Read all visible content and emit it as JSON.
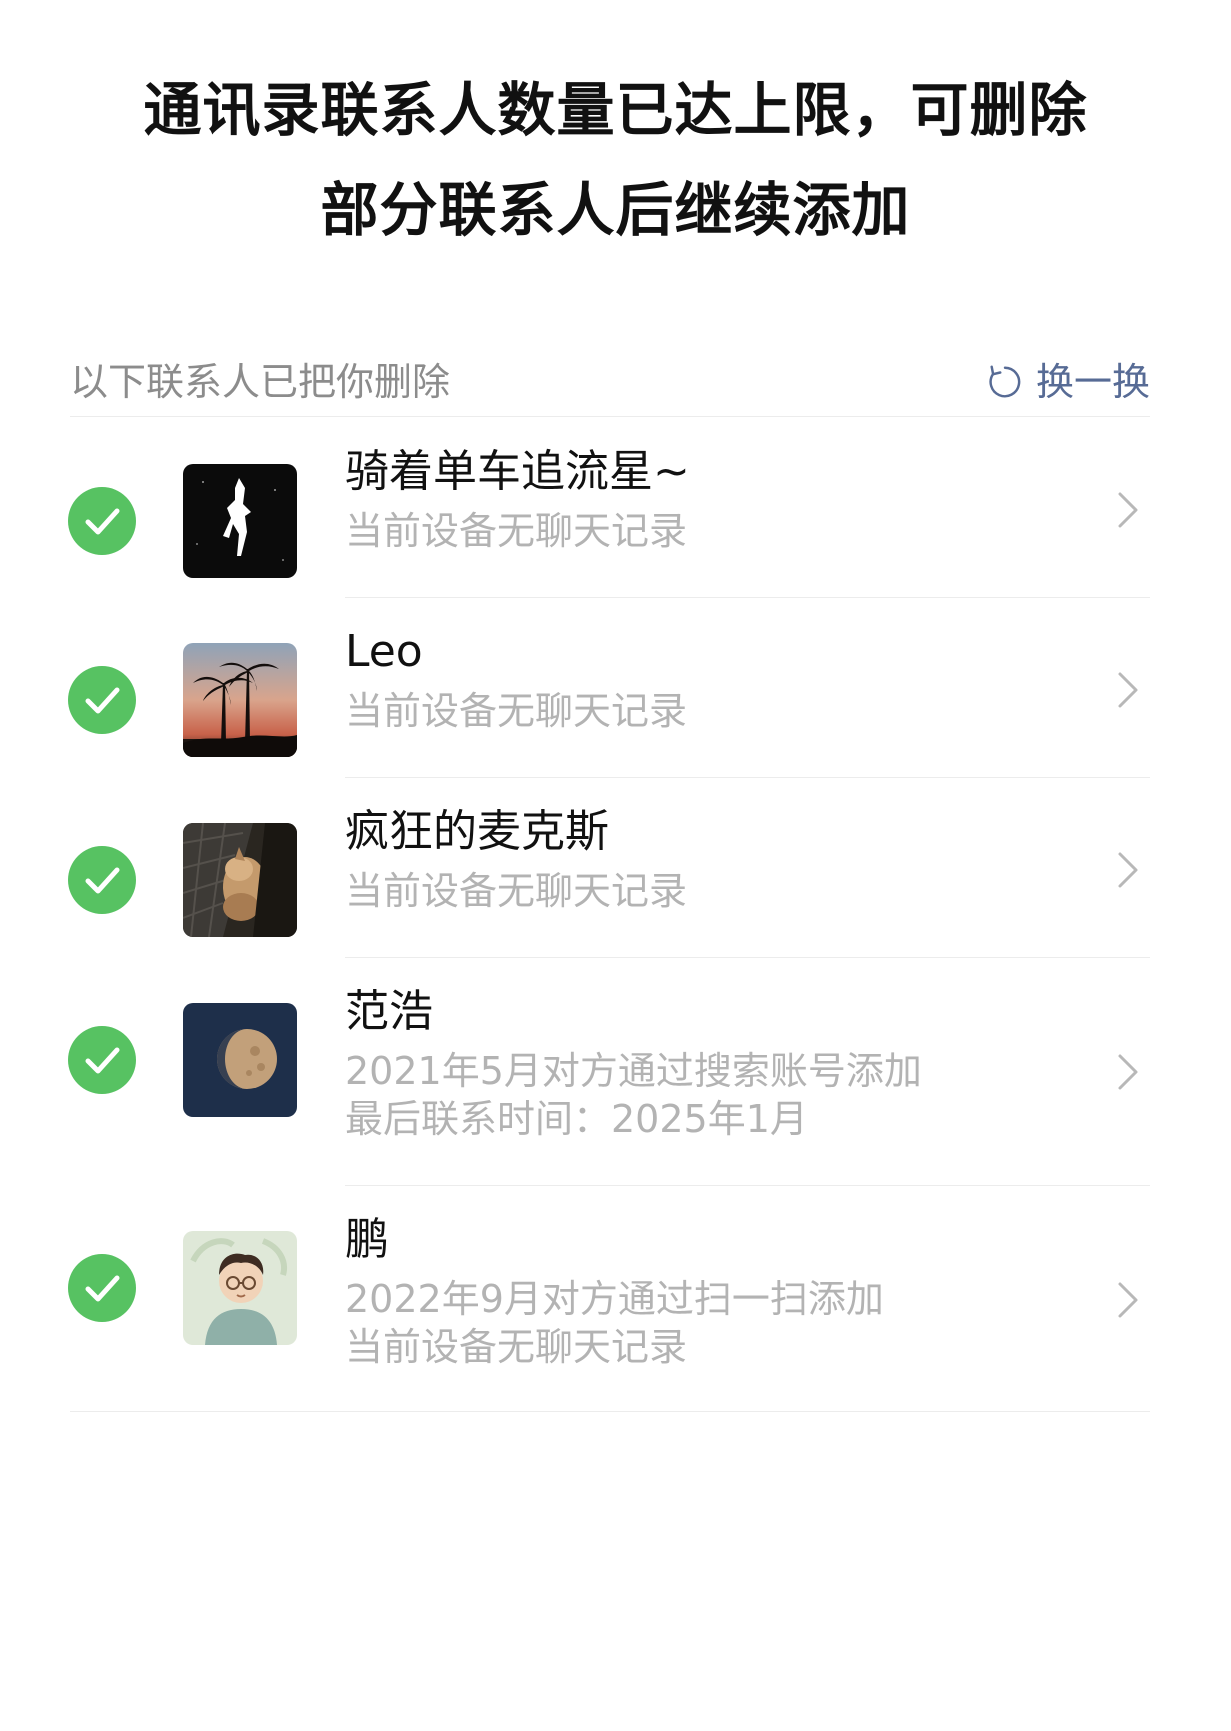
{
  "title": {
    "line1": "通讯录联系人数量已达上限，可删除",
    "line2": "部分联系人后继续添加"
  },
  "section": {
    "label": "以下联系人已把你删除",
    "refresh_label": "换一换",
    "refresh_icon": "refresh-icon"
  },
  "colors": {
    "check_green": "#57c262",
    "link_blue": "#576b95",
    "secondary_gray": "#b3b3b3"
  },
  "contacts": [
    {
      "name": "骑着单车追流星~",
      "line1": "当前设备无聊天记录",
      "line2": "",
      "checked": true
    },
    {
      "name": "Leo",
      "line1": "当前设备无聊天记录",
      "line2": "",
      "checked": true
    },
    {
      "name": "疯狂的麦克斯",
      "line1": "当前设备无聊天记录",
      "line2": "",
      "checked": true
    },
    {
      "name": "范浩",
      "line1": "2021年5月对方通过搜索账号添加",
      "line2": "最后联系时间：2025年1月",
      "checked": true
    },
    {
      "name": "鹏",
      "line1": "2022年9月对方通过扫一扫添加",
      "line2": "当前设备无聊天记录",
      "checked": true
    }
  ]
}
